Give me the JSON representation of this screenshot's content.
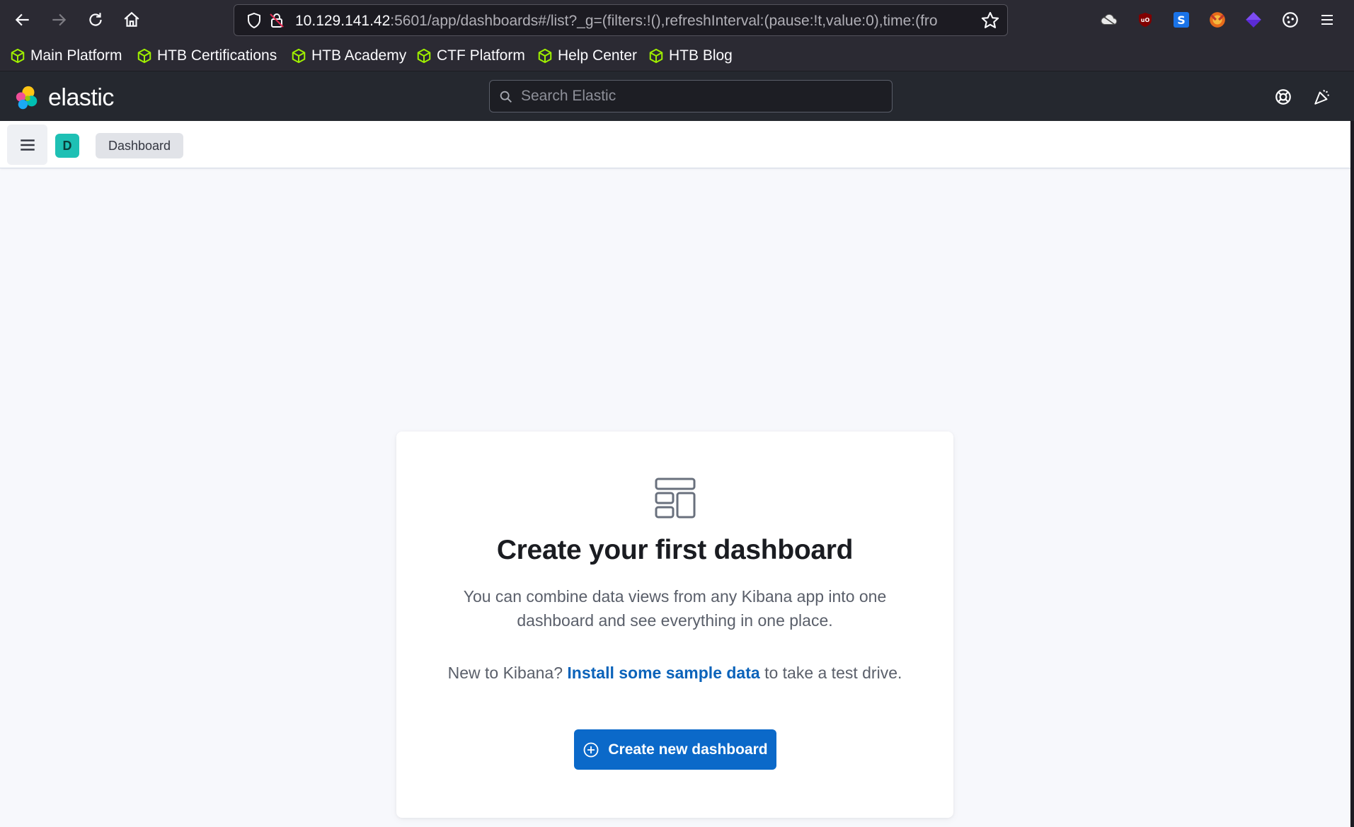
{
  "browser": {
    "url_host": "10.129.141.42",
    "url_rest": ":5601/app/dashboards#/list?_g=(filters:!(),refreshInterval:(pause:!t,value:0),time:(fro"
  },
  "bookmarks": [
    {
      "label": "Main Platform"
    },
    {
      "label": "HTB Certifications"
    },
    {
      "label": "HTB Academy"
    },
    {
      "label": "CTF Platform"
    },
    {
      "label": "Help Center"
    },
    {
      "label": "HTB Blog"
    }
  ],
  "header": {
    "logo_text": "elastic",
    "search_placeholder": "Search Elastic"
  },
  "breadcrumb": {
    "space_initial": "D",
    "current": "Dashboard"
  },
  "empty_state": {
    "title": "Create your first dashboard",
    "description": "You can combine data views from any Kibana app into one dashboard and see everything in one place.",
    "sample_prefix": "New to Kibana?",
    "sample_link": "Install some sample data",
    "sample_suffix": "to take a test drive.",
    "button_label": "Create new dashboard"
  },
  "colors": {
    "accent": "#0b69c9",
    "space_avatar": "#1ec0b4",
    "bookmark_icon": "#9fef00"
  }
}
